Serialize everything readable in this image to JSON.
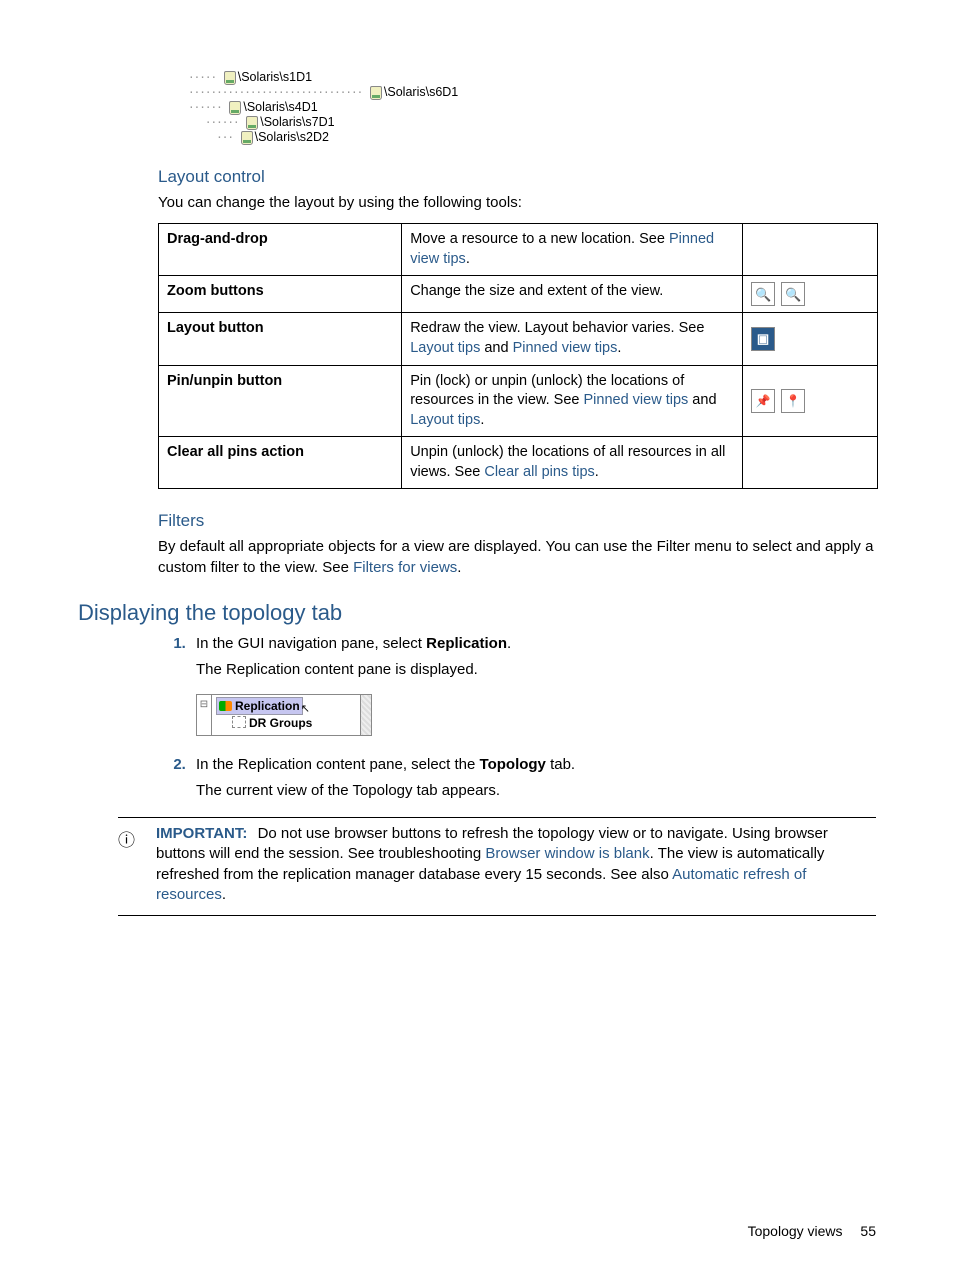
{
  "tree": {
    "n1": "\\Solaris\\s1D1",
    "n2": "\\Solaris\\s6D1",
    "n3": "\\Solaris\\s4D1",
    "n4": "\\Solaris\\s7D1",
    "n5": "\\Solaris\\s2D2"
  },
  "layout": {
    "heading": "Layout control",
    "intro": "You can change the layout by using the following tools:",
    "rows": {
      "r1": {
        "name": "Drag-and-drop",
        "desc_a": "Move a resource to a new location. See ",
        "link1": "Pinned view tips",
        "desc_b": "."
      },
      "r2": {
        "name": "Zoom buttons",
        "desc": "Change the size and extent of the view."
      },
      "r3": {
        "name": "Layout button",
        "desc_a": "Redraw the view. Layout behavior varies. See ",
        "link1": "Layout tips",
        "desc_b": " and ",
        "link2": "Pinned view tips",
        "desc_c": "."
      },
      "r4": {
        "name": "Pin/unpin button",
        "desc_a": "Pin (lock) or unpin (unlock) the locations of resources in the view. See ",
        "link1": "Pinned view tips",
        "desc_b": " and ",
        "link2": "Layout tips",
        "desc_c": "."
      },
      "r5": {
        "name": "Clear all pins action",
        "desc_a": "Unpin (unlock) the locations of all resources in all views. See ",
        "link1": "Clear all pins tips",
        "desc_b": "."
      }
    }
  },
  "filters": {
    "heading": "Filters",
    "text_a": "By default all appropriate objects for a view are displayed. You can use the Filter menu to select and apply a custom filter to the view. See ",
    "link": "Filters for views",
    "text_b": "."
  },
  "display": {
    "heading": "Displaying the topology tab",
    "step1_a": "In the GUI navigation pane, select ",
    "step1_bold": "Replication",
    "step1_b": ".",
    "step1_result": "The Replication content pane is displayed.",
    "nav_item1": "Replication",
    "nav_item2": "DR Groups",
    "step2_a": "In the Replication content pane, select the ",
    "step2_bold": "Topology",
    "step2_b": " tab.",
    "step2_result": "The current view of the Topology tab appears."
  },
  "important": {
    "label": "IMPORTANT:",
    "text_a": "Do not use browser buttons to refresh the topology view or to navigate. Using browser buttons will end the session. See troubleshooting ",
    "link1": "Browser window is blank",
    "text_b": ". The view is automatically refreshed from the replication manager database every 15 seconds. See also ",
    "link2": "Automatic refresh of resources",
    "text_c": "."
  },
  "footer": {
    "title": "Topology views",
    "page": "55"
  }
}
